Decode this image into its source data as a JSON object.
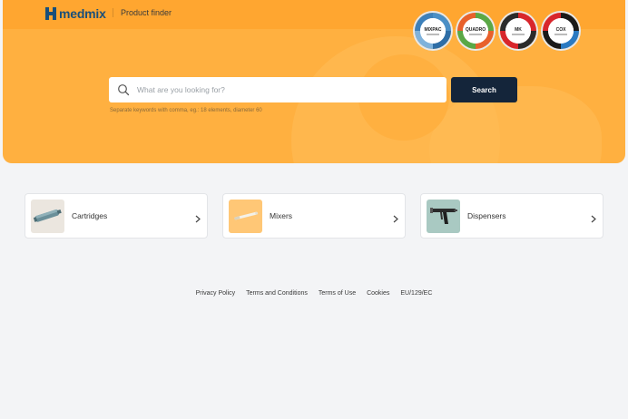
{
  "header": {
    "brand": "medmix",
    "section": "Product finder",
    "badges": [
      {
        "label": "MIXPAC",
        "ring": "#4a8fc6",
        "icon": "mixpac-badge-icon"
      },
      {
        "label": "QUADRO",
        "ring": "#e8612c",
        "ring2": "#5aa846",
        "icon": "quadro-badge-icon"
      },
      {
        "label": "MK",
        "ring": "#2b2b2b",
        "ring2": "#d8262c",
        "icon": "mk-badge-icon"
      },
      {
        "label": "COX",
        "ring": "#1a1a1a",
        "ring2": "#2a7ac2",
        "icon": "cox-badge-icon"
      }
    ]
  },
  "search": {
    "placeholder": "What are you looking for?",
    "value": "",
    "button_label": "Search",
    "hint": "Separate keywords with comma, eg.: 18 elements, diameter 60"
  },
  "categories": [
    {
      "label": "Cartridges",
      "icon": "cartridge-icon",
      "thumb_bg": "#ebe6df"
    },
    {
      "label": "Mixers",
      "icon": "mixer-icon",
      "thumb_bg": "#ffc776"
    },
    {
      "label": "Dispensers",
      "icon": "dispenser-icon",
      "thumb_bg": "#a9c9c2"
    }
  ],
  "footer": {
    "links": [
      "Privacy Policy",
      "Terms and Conditions",
      "Terms of Use",
      "Cookies",
      "EU/129/EC"
    ]
  },
  "colors": {
    "accent_orange": "#ffb040",
    "dark_button": "#14253a",
    "brand_blue": "#1a4f7a"
  }
}
